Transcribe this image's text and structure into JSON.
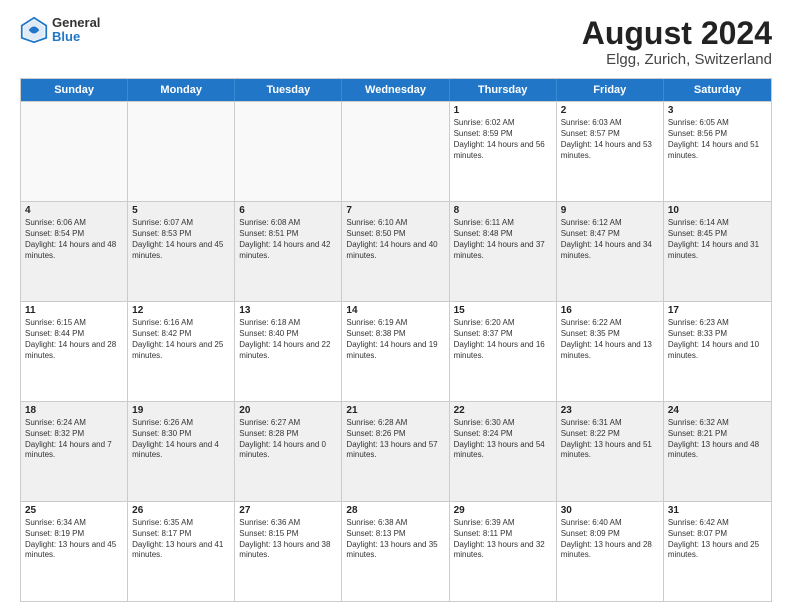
{
  "header": {
    "logo": {
      "general": "General",
      "blue": "Blue"
    },
    "title": "August 2024",
    "subtitle": "Elgg, Zurich, Switzerland"
  },
  "calendar": {
    "days": [
      "Sunday",
      "Monday",
      "Tuesday",
      "Wednesday",
      "Thursday",
      "Friday",
      "Saturday"
    ],
    "rows": [
      [
        {
          "day": "",
          "empty": true
        },
        {
          "day": "",
          "empty": true
        },
        {
          "day": "",
          "empty": true
        },
        {
          "day": "",
          "empty": true
        },
        {
          "day": "1",
          "sunrise": "6:02 AM",
          "sunset": "8:59 PM",
          "daylight": "14 hours and 56 minutes."
        },
        {
          "day": "2",
          "sunrise": "6:03 AM",
          "sunset": "8:57 PM",
          "daylight": "14 hours and 53 minutes."
        },
        {
          "day": "3",
          "sunrise": "6:05 AM",
          "sunset": "8:56 PM",
          "daylight": "14 hours and 51 minutes."
        }
      ],
      [
        {
          "day": "4",
          "sunrise": "6:06 AM",
          "sunset": "8:54 PM",
          "daylight": "14 hours and 48 minutes.",
          "shaded": true
        },
        {
          "day": "5",
          "sunrise": "6:07 AM",
          "sunset": "8:53 PM",
          "daylight": "14 hours and 45 minutes.",
          "shaded": true
        },
        {
          "day": "6",
          "sunrise": "6:08 AM",
          "sunset": "8:51 PM",
          "daylight": "14 hours and 42 minutes.",
          "shaded": true
        },
        {
          "day": "7",
          "sunrise": "6:10 AM",
          "sunset": "8:50 PM",
          "daylight": "14 hours and 40 minutes.",
          "shaded": true
        },
        {
          "day": "8",
          "sunrise": "6:11 AM",
          "sunset": "8:48 PM",
          "daylight": "14 hours and 37 minutes.",
          "shaded": true
        },
        {
          "day": "9",
          "sunrise": "6:12 AM",
          "sunset": "8:47 PM",
          "daylight": "14 hours and 34 minutes.",
          "shaded": true
        },
        {
          "day": "10",
          "sunrise": "6:14 AM",
          "sunset": "8:45 PM",
          "daylight": "14 hours and 31 minutes.",
          "shaded": true
        }
      ],
      [
        {
          "day": "11",
          "sunrise": "6:15 AM",
          "sunset": "8:44 PM",
          "daylight": "14 hours and 28 minutes."
        },
        {
          "day": "12",
          "sunrise": "6:16 AM",
          "sunset": "8:42 PM",
          "daylight": "14 hours and 25 minutes."
        },
        {
          "day": "13",
          "sunrise": "6:18 AM",
          "sunset": "8:40 PM",
          "daylight": "14 hours and 22 minutes."
        },
        {
          "day": "14",
          "sunrise": "6:19 AM",
          "sunset": "8:38 PM",
          "daylight": "14 hours and 19 minutes."
        },
        {
          "day": "15",
          "sunrise": "6:20 AM",
          "sunset": "8:37 PM",
          "daylight": "14 hours and 16 minutes."
        },
        {
          "day": "16",
          "sunrise": "6:22 AM",
          "sunset": "8:35 PM",
          "daylight": "14 hours and 13 minutes."
        },
        {
          "day": "17",
          "sunrise": "6:23 AM",
          "sunset": "8:33 PM",
          "daylight": "14 hours and 10 minutes."
        }
      ],
      [
        {
          "day": "18",
          "sunrise": "6:24 AM",
          "sunset": "8:32 PM",
          "daylight": "14 hours and 7 minutes.",
          "shaded": true
        },
        {
          "day": "19",
          "sunrise": "6:26 AM",
          "sunset": "8:30 PM",
          "daylight": "14 hours and 4 minutes.",
          "shaded": true
        },
        {
          "day": "20",
          "sunrise": "6:27 AM",
          "sunset": "8:28 PM",
          "daylight": "14 hours and 0 minutes.",
          "shaded": true
        },
        {
          "day": "21",
          "sunrise": "6:28 AM",
          "sunset": "8:26 PM",
          "daylight": "13 hours and 57 minutes.",
          "shaded": true
        },
        {
          "day": "22",
          "sunrise": "6:30 AM",
          "sunset": "8:24 PM",
          "daylight": "13 hours and 54 minutes.",
          "shaded": true
        },
        {
          "day": "23",
          "sunrise": "6:31 AM",
          "sunset": "8:22 PM",
          "daylight": "13 hours and 51 minutes.",
          "shaded": true
        },
        {
          "day": "24",
          "sunrise": "6:32 AM",
          "sunset": "8:21 PM",
          "daylight": "13 hours and 48 minutes.",
          "shaded": true
        }
      ],
      [
        {
          "day": "25",
          "sunrise": "6:34 AM",
          "sunset": "8:19 PM",
          "daylight": "13 hours and 45 minutes."
        },
        {
          "day": "26",
          "sunrise": "6:35 AM",
          "sunset": "8:17 PM",
          "daylight": "13 hours and 41 minutes."
        },
        {
          "day": "27",
          "sunrise": "6:36 AM",
          "sunset": "8:15 PM",
          "daylight": "13 hours and 38 minutes."
        },
        {
          "day": "28",
          "sunrise": "6:38 AM",
          "sunset": "8:13 PM",
          "daylight": "13 hours and 35 minutes."
        },
        {
          "day": "29",
          "sunrise": "6:39 AM",
          "sunset": "8:11 PM",
          "daylight": "13 hours and 32 minutes."
        },
        {
          "day": "30",
          "sunrise": "6:40 AM",
          "sunset": "8:09 PM",
          "daylight": "13 hours and 28 minutes."
        },
        {
          "day": "31",
          "sunrise": "6:42 AM",
          "sunset": "8:07 PM",
          "daylight": "13 hours and 25 minutes."
        }
      ]
    ]
  }
}
